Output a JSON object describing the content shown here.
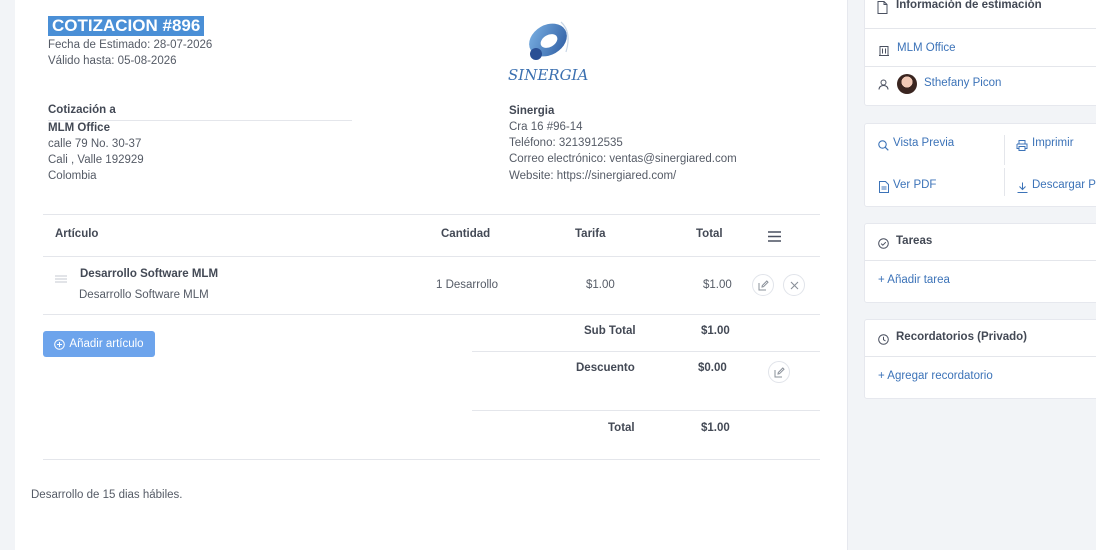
{
  "estimate": {
    "title": "COTIZACION #896",
    "date_line": "Fecha de Estimado: 28-07-2026",
    "valid_line": "Válido hasta: 05-08-2026"
  },
  "logo": {
    "text": "SINERGIA"
  },
  "client": {
    "heading": "Cotización a",
    "name": "MLM Office",
    "address1": "calle 79 No. 30-37",
    "address2": "Cali , Valle 192929",
    "country": "Colombia"
  },
  "company": {
    "name": "Sinergia",
    "address": "Cra 16 #96-14",
    "phone": "Teléfono: 3213912535",
    "email": "Correo electrónico: ventas@sinergiared.com",
    "website": "Website: https://sinergiared.com/"
  },
  "table": {
    "headers": {
      "item": "Artículo",
      "qty": "Cantidad",
      "rate": "Tarifa",
      "total": "Total"
    },
    "rows": [
      {
        "title": "Desarrollo Software MLM",
        "desc": "Desarrollo Software MLM",
        "qty": "1 Desarrollo",
        "rate": "$1.00",
        "total": "$1.00"
      }
    ]
  },
  "add_item_label": "Añadir artículo",
  "summary": {
    "subtotal_label": "Sub Total",
    "subtotal_value": "$1.00",
    "discount_label": "Descuento",
    "discount_value": "$0.00",
    "total_label": "Total",
    "total_value": "$1.00"
  },
  "note": "Desarrollo de 15 dias hábiles.",
  "sidebar": {
    "info_title": "Información de estimación",
    "client": "MLM Office",
    "user": "Sthefany Picon",
    "actions": {
      "preview": "Vista Previa",
      "print": "Imprimir",
      "view_pdf": "Ver PDF",
      "download": "Descargar PDF"
    },
    "tasks_title": "Tareas",
    "add_task": "Añadir tarea",
    "reminders_title": "Recordatorios (Privado)",
    "add_reminder": "Agregar recordatorio"
  },
  "colors": {
    "accent": "#4a8fd6",
    "button": "#6da4ec",
    "link": "#3c73b8"
  }
}
